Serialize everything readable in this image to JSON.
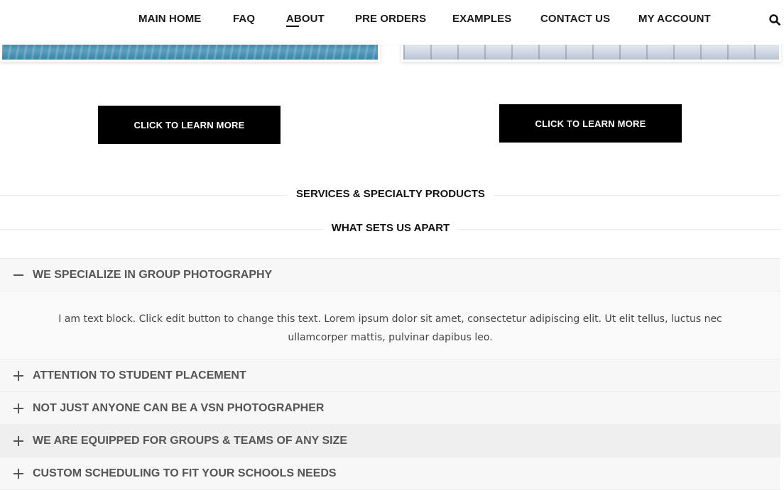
{
  "nav": {
    "items": [
      {
        "label": "MAIN HOME"
      },
      {
        "label": "FAQ"
      },
      {
        "label": "ABOUT"
      },
      {
        "label": "PRE ORDERS"
      },
      {
        "label": "EXAMPLES"
      },
      {
        "label": "CONTACT US"
      },
      {
        "label": "MY ACCOUNT"
      }
    ],
    "active": "ABOUT",
    "search_icon": "search-icon"
  },
  "cards": [
    {
      "button_label": "CLICK TO LEARN MORE",
      "image": "swimming-pool-photo"
    },
    {
      "button_label": "CLICK TO LEARN MORE",
      "image": "gym-ceiling-photo"
    }
  ],
  "sections": {
    "services_heading": "SERVICES & SPECIALTY PRODUCTS",
    "apart_heading": "WHAT SETS US APART"
  },
  "accordion": {
    "items": [
      {
        "title": "WE SPECIALIZE IN GROUP PHOTOGRAPHY",
        "expanded": true,
        "body": "I am text block. Click edit button to change this text. Lorem ipsum dolor sit amet, consectetur adipiscing elit. Ut elit tellus, luctus nec ullamcorper mattis, pulvinar dapibus leo."
      },
      {
        "title": "ATTENTION TO STUDENT PLACEMENT",
        "expanded": false
      },
      {
        "title": "NOT JUST ANYONE CAN BE A VSN PHOTOGRAPHER",
        "expanded": false
      },
      {
        "title": "WE ARE EQUIPPED FOR GROUPS & TEAMS OF ANY SIZE",
        "expanded": false
      },
      {
        "title": "CUSTOM SCHEDULING TO FIT YOUR SCHOOLS NEEDS",
        "expanded": false
      }
    ]
  },
  "colors": {
    "accent": "#000000",
    "accordion_bg": "#f7f7f7",
    "accordion_text": "#555555"
  }
}
